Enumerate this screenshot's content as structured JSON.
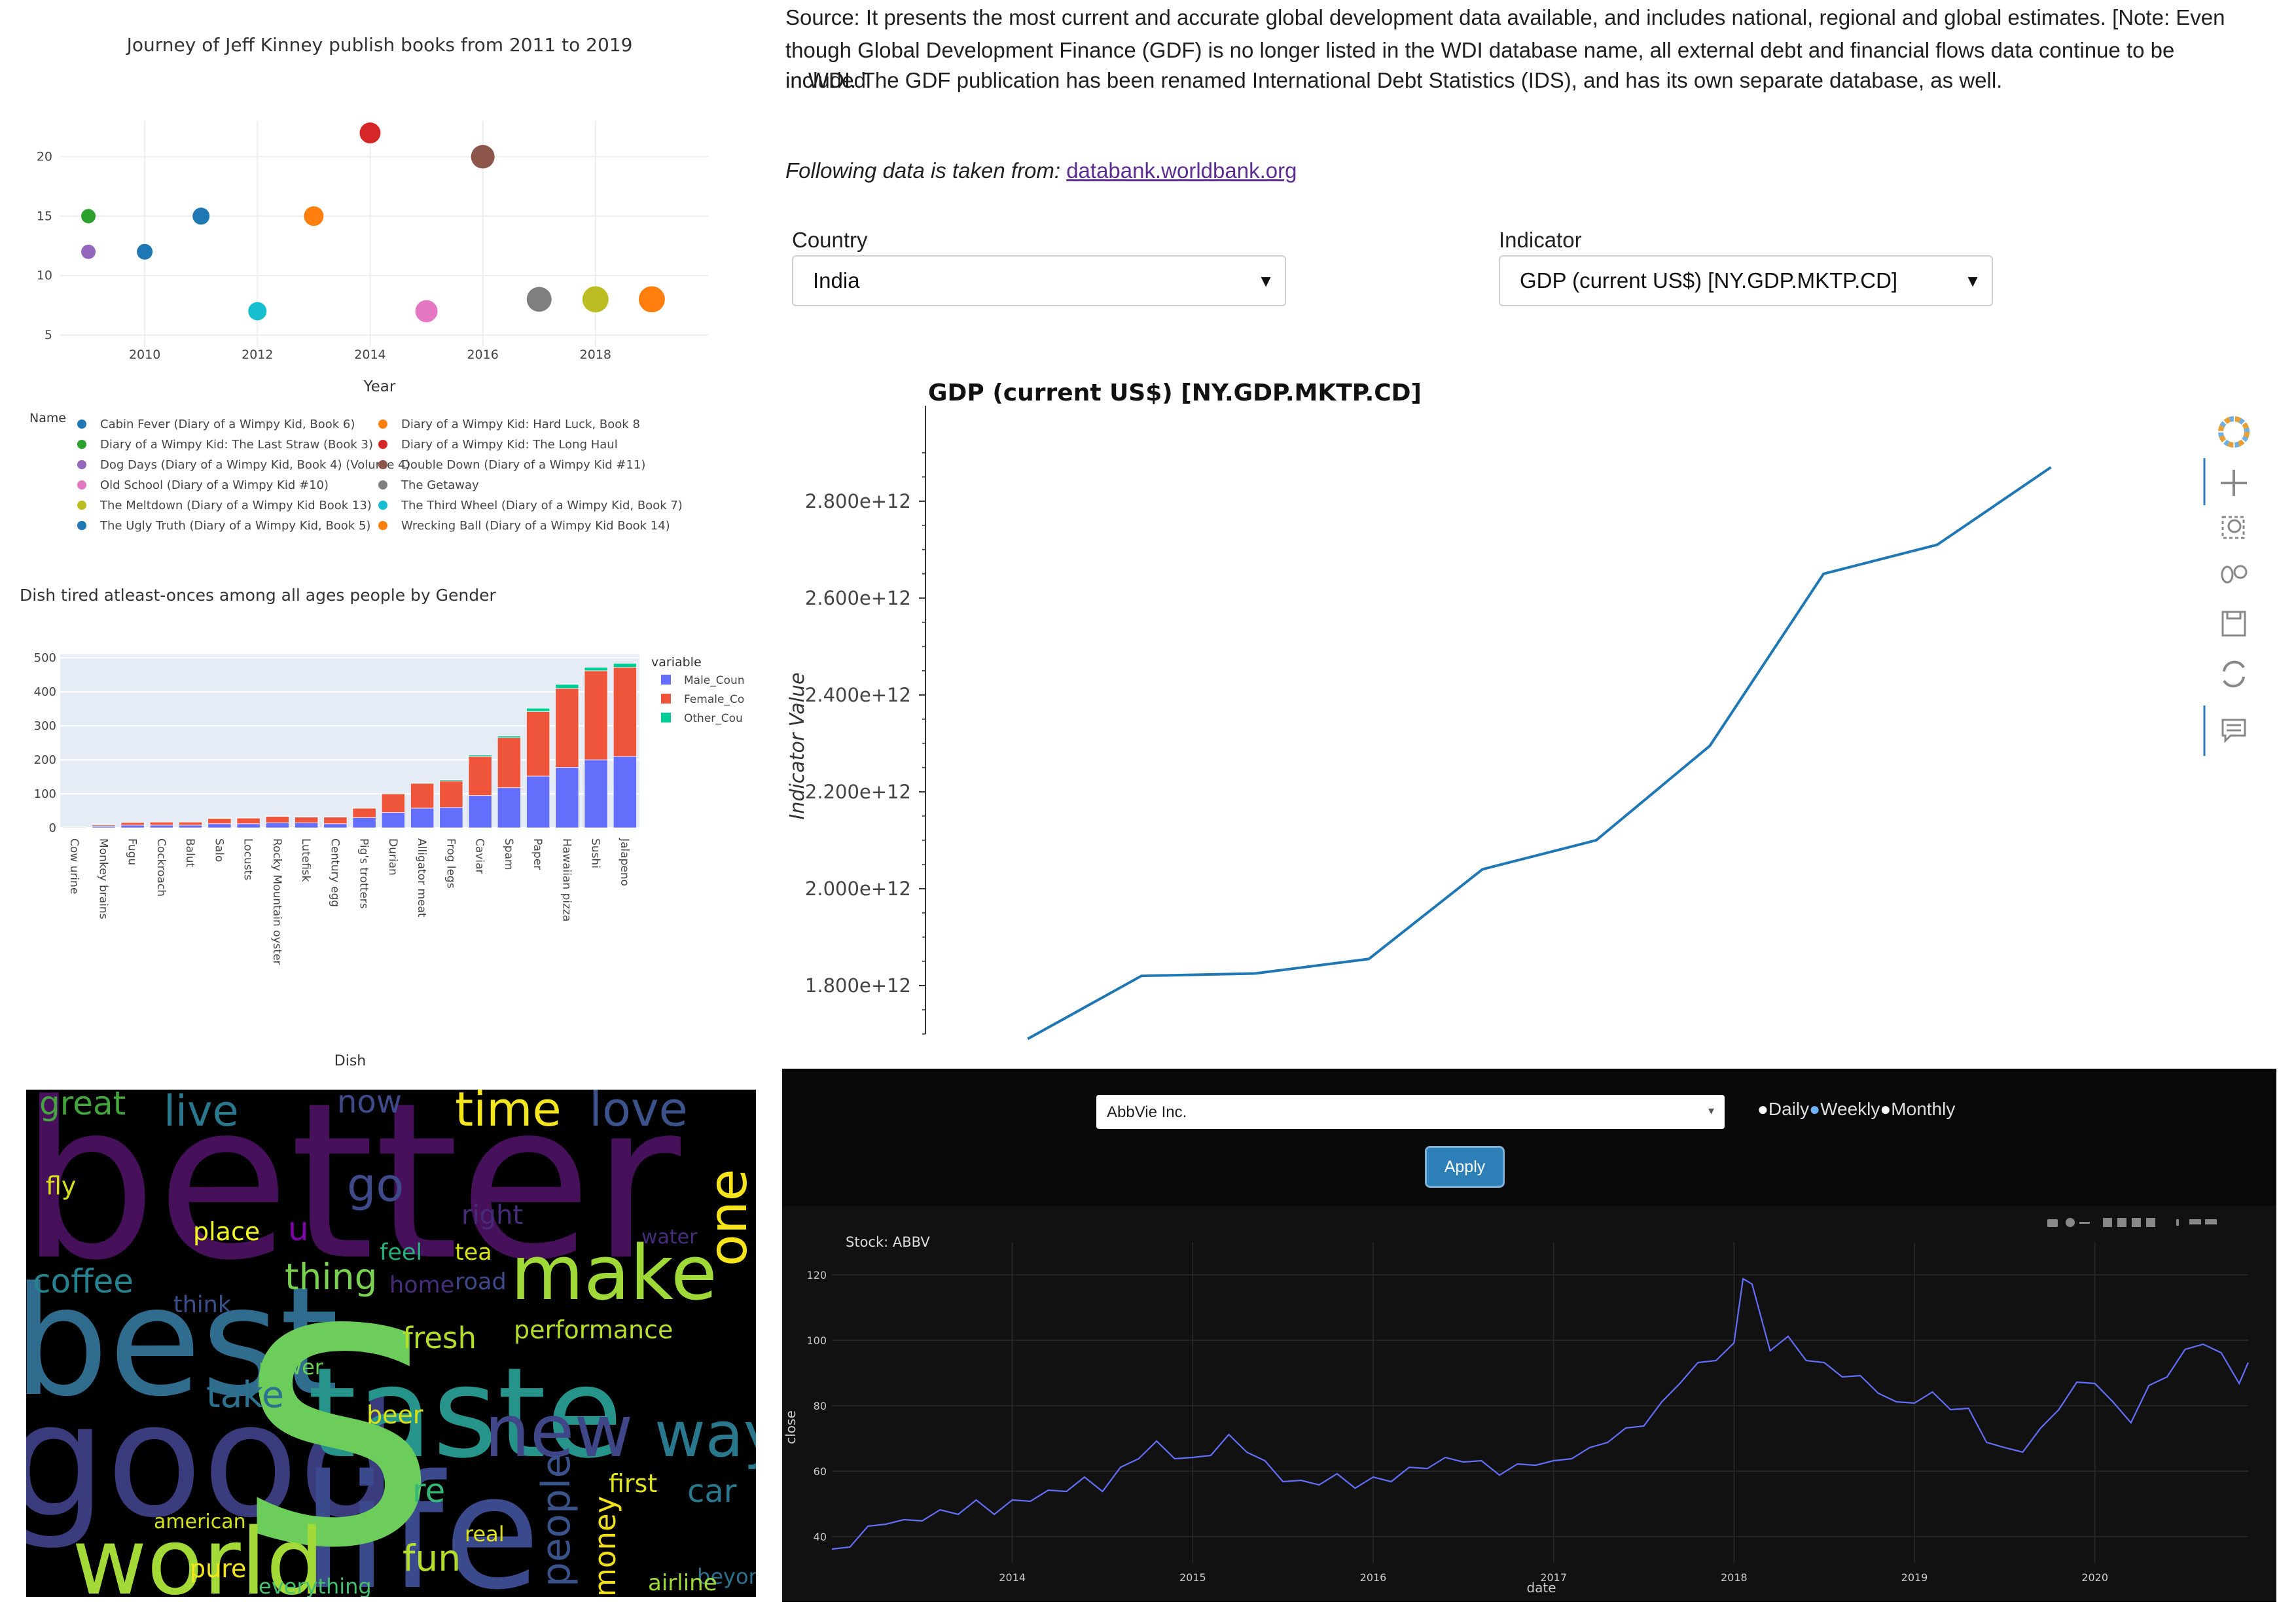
{
  "panels": {
    "books": {
      "title": "Journey of Jeff Kinney publish books from 2011 to 2019",
      "xlabel": "Year",
      "legend_title": "Name"
    },
    "dishes": {
      "title": "Dish tired atleast-onces among all ages people by Gender",
      "xlabel": "Dish",
      "legend_title": "variable"
    },
    "worldbank": {
      "intro_line1": "Source: It presents the most current and accurate global development data available, and includes national, regional and global estimates. [Note: Even",
      "intro_line2": "though Global Development Finance (GDF) is no longer listed in the WDI database name, all external debt and financial flows data continue to be included",
      "intro_line3": "in WDI. The GDF publication has been renamed International Debt Statistics (IDS), and has its own separate database, as well.",
      "source_prefix": "Following data is taken from:",
      "source_link": "databank.worldbank.org",
      "country_label": "Country",
      "country_value": "India",
      "indicator_label": "Indicator",
      "indicator_value": "GDP (current US$) [NY.GDP.MKTP.CD]",
      "chart_title": "GDP (current US$) [NY.GDP.MKTP.CD]",
      "ylabel": "Indicator Value"
    },
    "stock": {
      "selected_company": "AbbVie Inc.",
      "radio_daily": "Daily",
      "radio_weekly": "Weekly",
      "radio_monthly": "Monthly",
      "apply_label": "Apply",
      "chart_title": "Stock: ABBV",
      "xlabel": "date",
      "ylabel": "close"
    }
  },
  "colors": {
    "blue": "#1f77b4",
    "orange": "#ff7f0e",
    "green": "#2ca02c",
    "red": "#d62728",
    "purple": "#9467bd",
    "brown": "#8c564b",
    "pink": "#e377c2",
    "gray": "#7f7f7f",
    "olive": "#bcbd22",
    "cyan": "#17becf",
    "male": "#636efa",
    "female": "#ef553b",
    "other": "#00cc96",
    "gdp_line": "#1f77b4",
    "stock_line": "#636efa"
  },
  "chart_data": [
    {
      "type": "scatter",
      "title": "Journey of Jeff Kinney publish books from 2011 to 2019",
      "xlabel": "Year",
      "ylabel": "",
      "x_ticks": [
        2010,
        2012,
        2014,
        2016,
        2018
      ],
      "y_ticks": [
        5,
        10,
        15,
        20
      ],
      "xlim": [
        2008.5,
        2020
      ],
      "ylim": [
        4,
        23
      ],
      "legend_placement": "bottom",
      "series": [
        {
          "name": "Cabin Fever (Diary of a Wimpy Kid, Book 6)",
          "color": "#1f77b4",
          "points": [
            [
              2011,
              15
            ]
          ]
        },
        {
          "name": "Diary of a Wimpy Kid: Hard Luck, Book 8",
          "color": "#ff7f0e",
          "points": [
            [
              2013,
              15
            ]
          ]
        },
        {
          "name": "Diary of a Wimpy Kid: The Last Straw (Book 3)",
          "color": "#2ca02c",
          "points": [
            [
              2009,
              15
            ]
          ]
        },
        {
          "name": "Diary of a Wimpy Kid: The Long Haul",
          "color": "#d62728",
          "points": [
            [
              2014,
              22
            ]
          ]
        },
        {
          "name": "Dog Days (Diary of a Wimpy Kid, Book 4) (Volume 4)",
          "color": "#9467bd",
          "points": [
            [
              2009,
              12
            ]
          ]
        },
        {
          "name": "Double Down (Diary of a Wimpy Kid #11)",
          "color": "#8c564b",
          "points": [
            [
              2016,
              20
            ]
          ]
        },
        {
          "name": "Old School (Diary of a Wimpy Kid #10)",
          "color": "#e377c2",
          "points": [
            [
              2015,
              7
            ]
          ]
        },
        {
          "name": "The Getaway",
          "color": "#7f7f7f",
          "points": [
            [
              2017,
              8
            ]
          ]
        },
        {
          "name": "The Meltdown (Diary of a Wimpy Kid Book 13)",
          "color": "#bcbd22",
          "points": [
            [
              2018,
              8
            ]
          ]
        },
        {
          "name": "The Third Wheel (Diary of a Wimpy Kid, Book 7)",
          "color": "#17becf",
          "points": [
            [
              2012,
              7
            ]
          ]
        },
        {
          "name": "The Ugly Truth (Diary of a Wimpy Kid, Book 5)",
          "color": "#1f77b4",
          "points": [
            [
              2010,
              12
            ]
          ]
        },
        {
          "name": "Wrecking Ball (Diary of a Wimpy Kid Book 14)",
          "color": "#ff7f0e",
          "points": [
            [
              2019,
              8
            ]
          ]
        }
      ]
    },
    {
      "type": "bar",
      "stacked": true,
      "title": "Dish tired atleast-onces among all ages people by Gender",
      "xlabel": "Dish",
      "ylabel": "",
      "ylim": [
        0,
        510
      ],
      "y_ticks": [
        0,
        100,
        200,
        300,
        400,
        500
      ],
      "legend_placement": "right",
      "categories": [
        "Cow urine",
        "Monkey brains",
        "Fugu",
        "Cockroach",
        "Balut",
        "Salo",
        "Locusts",
        "Rocky Mountain oyster",
        "Lutefisk",
        "Century egg",
        "Pig's trotters",
        "Durian",
        "Alligator meat",
        "Frog legs",
        "Caviar",
        "Spam",
        "Paper",
        "Hawaiian pizza",
        "Sushi",
        "Jalapeno"
      ],
      "series": [
        {
          "name": "Male_Coun",
          "color": "#636efa",
          "values": [
            2,
            5,
            8,
            8,
            8,
            12,
            12,
            15,
            15,
            12,
            30,
            45,
            58,
            60,
            95,
            118,
            152,
            178,
            200,
            210
          ]
        },
        {
          "name": "Female_Co",
          "color": "#ef553b",
          "values": [
            1,
            3,
            8,
            9,
            9,
            16,
            17,
            19,
            17,
            20,
            28,
            55,
            73,
            78,
            115,
            147,
            190,
            232,
            262,
            262
          ]
        },
        {
          "name": "Other_Cou",
          "color": "#00cc96",
          "values": [
            0,
            0,
            0,
            0,
            0,
            1,
            1,
            1,
            1,
            1,
            1,
            2,
            2,
            3,
            4,
            5,
            10,
            12,
            10,
            12
          ]
        }
      ]
    },
    {
      "type": "line",
      "title": "GDP (current US$) [NY.GDP.MKTP.CD]",
      "xlabel": "",
      "ylabel": "Indicator Value",
      "y_ticks_labels": [
        "1.800e+12",
        "2.000e+12",
        "2.200e+12",
        "2.400e+12",
        "2.600e+12",
        "2.800e+12"
      ],
      "y_ticks": [
        1800000000000.0,
        2000000000000.0,
        2200000000000.0,
        2400000000000.0,
        2600000000000.0,
        2800000000000.0
      ],
      "ylim": [
        1700000000000.0,
        2970000000000.0
      ],
      "xlim": [
        0,
        11.25
      ],
      "series": [
        {
          "name": "",
          "color": "#1f77b4",
          "values": [
            1690000000000.0,
            1820000000000.0,
            1825000000000.0,
            1855000000000.0,
            2040000000000.0,
            2100000000000.0,
            2295000000000.0,
            2650000000000.0,
            2710000000000.0,
            2870000000000.0
          ]
        }
      ]
    },
    {
      "type": "line",
      "title": "Stock: ABBV",
      "xlabel": "date",
      "ylabel": "close",
      "x_ticks": [
        "2014",
        "2015",
        "2016",
        "2017",
        "2018",
        "2019",
        "2020"
      ],
      "y_ticks": [
        40,
        60,
        80,
        100,
        120
      ],
      "xlim": [
        2013.0,
        2020.85
      ],
      "ylim": [
        32,
        130
      ],
      "series": [
        {
          "name": "ABBV",
          "color": "#636efa",
          "x": [
            2013.0,
            2013.1,
            2013.2,
            2013.3,
            2013.4,
            2013.5,
            2013.6,
            2013.7,
            2013.8,
            2013.9,
            2014.0,
            2014.1,
            2014.2,
            2014.3,
            2014.4,
            2014.5,
            2014.6,
            2014.7,
            2014.8,
            2014.9,
            2015.0,
            2015.1,
            2015.2,
            2015.3,
            2015.4,
            2015.5,
            2015.6,
            2015.7,
            2015.8,
            2015.9,
            2016.0,
            2016.1,
            2016.2,
            2016.3,
            2016.4,
            2016.5,
            2016.6,
            2016.7,
            2016.8,
            2016.9,
            2017.0,
            2017.1,
            2017.2,
            2017.3,
            2017.4,
            2017.5,
            2017.6,
            2017.7,
            2017.8,
            2017.9,
            2018.0,
            2018.05,
            2018.1,
            2018.2,
            2018.3,
            2018.4,
            2018.5,
            2018.6,
            2018.7,
            2018.8,
            2018.9,
            2019.0,
            2019.1,
            2019.2,
            2019.3,
            2019.4,
            2019.5,
            2019.6,
            2019.7,
            2019.8,
            2019.9,
            2020.0,
            2020.1,
            2020.2,
            2020.3,
            2020.4,
            2020.5,
            2020.6,
            2020.7,
            2020.8,
            2020.85
          ],
          "values": [
            35,
            38,
            42,
            45,
            44,
            46,
            47,
            48,
            50,
            48,
            50,
            52,
            53,
            55,
            57,
            55,
            60,
            65,
            68,
            65,
            63,
            66,
            70,
            67,
            62,
            58,
            56,
            57,
            58,
            56,
            57,
            58,
            60,
            62,
            63,
            64,
            62,
            60,
            61,
            63,
            62,
            65,
            66,
            70,
            72,
            75,
            80,
            88,
            92,
            95,
            98,
            120,
            116,
            98,
            100,
            95,
            92,
            90,
            88,
            85,
            80,
            82,
            83,
            80,
            78,
            70,
            66,
            67,
            72,
            80,
            86,
            88,
            80,
            76,
            85,
            90,
            96,
            100,
            95,
            88,
            92
          ]
        }
      ]
    }
  ]
}
